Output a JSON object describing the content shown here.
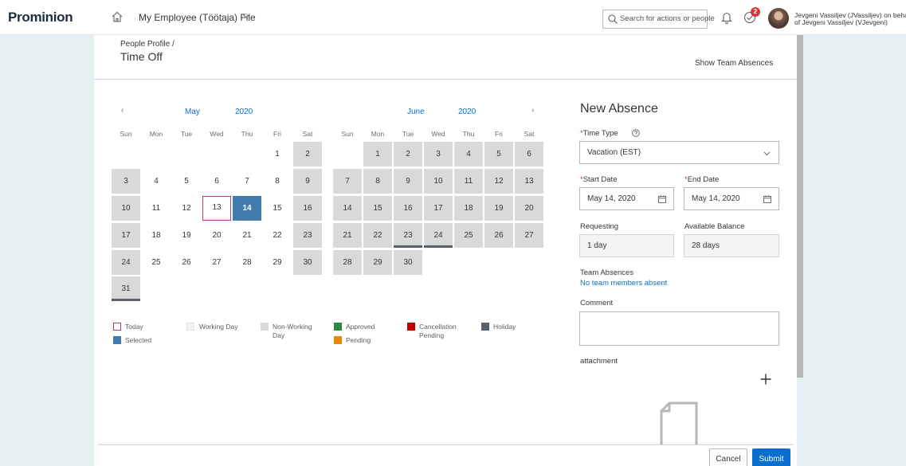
{
  "header": {
    "logo_main": "Prominion",
    "app_title": "My Employee (Töötaja) File",
    "search_placeholder": "Search for actions or people",
    "notifications_count": "2",
    "user_line1": "Jevgeni Vassiljev (JVassiljev) on behalf",
    "user_line2": "of Jevgeni Vassiljev (VJevgeni)"
  },
  "page": {
    "breadcrumb": "People Profile /",
    "title": "Time Off",
    "team_link": "Show Team Absences"
  },
  "calendar": {
    "weekdays": [
      "Sun",
      "Mon",
      "Tue",
      "Wed",
      "Thu",
      "Fri",
      "Sat"
    ],
    "months": [
      {
        "name": "May",
        "year": "2020",
        "weeks": [
          [
            null,
            null,
            null,
            null,
            null,
            {
              "d": "1",
              "t": "working"
            },
            {
              "d": "2",
              "t": "nonworking"
            }
          ],
          [
            {
              "d": "3",
              "t": "nonworking"
            },
            {
              "d": "4",
              "t": "working"
            },
            {
              "d": "5",
              "t": "working"
            },
            {
              "d": "6",
              "t": "working"
            },
            {
              "d": "7",
              "t": "working"
            },
            {
              "d": "8",
              "t": "working"
            },
            {
              "d": "9",
              "t": "nonworking"
            }
          ],
          [
            {
              "d": "10",
              "t": "nonworking"
            },
            {
              "d": "11",
              "t": "working"
            },
            {
              "d": "12",
              "t": "working"
            },
            {
              "d": "13",
              "t": "today"
            },
            {
              "d": "14",
              "t": "selected"
            },
            {
              "d": "15",
              "t": "working"
            },
            {
              "d": "16",
              "t": "nonworking"
            }
          ],
          [
            {
              "d": "17",
              "t": "nonworking"
            },
            {
              "d": "18",
              "t": "working"
            },
            {
              "d": "19",
              "t": "working"
            },
            {
              "d": "20",
              "t": "working"
            },
            {
              "d": "21",
              "t": "working"
            },
            {
              "d": "22",
              "t": "working"
            },
            {
              "d": "23",
              "t": "nonworking"
            }
          ],
          [
            {
              "d": "24",
              "t": "nonworking"
            },
            {
              "d": "25",
              "t": "working"
            },
            {
              "d": "26",
              "t": "working"
            },
            {
              "d": "27",
              "t": "working"
            },
            {
              "d": "28",
              "t": "working"
            },
            {
              "d": "29",
              "t": "working"
            },
            {
              "d": "30",
              "t": "nonworking"
            }
          ],
          [
            {
              "d": "31",
              "t": "nonworking",
              "holiday": true
            },
            null,
            null,
            null,
            null,
            null,
            null
          ]
        ]
      },
      {
        "name": "June",
        "year": "2020",
        "weeks": [
          [
            null,
            {
              "d": "1",
              "t": "nonworking"
            },
            {
              "d": "2",
              "t": "nonworking"
            },
            {
              "d": "3",
              "t": "nonworking"
            },
            {
              "d": "4",
              "t": "nonworking"
            },
            {
              "d": "5",
              "t": "nonworking"
            },
            {
              "d": "6",
              "t": "nonworking"
            }
          ],
          [
            {
              "d": "7",
              "t": "nonworking"
            },
            {
              "d": "8",
              "t": "nonworking"
            },
            {
              "d": "9",
              "t": "nonworking"
            },
            {
              "d": "10",
              "t": "nonworking"
            },
            {
              "d": "11",
              "t": "nonworking"
            },
            {
              "d": "12",
              "t": "nonworking"
            },
            {
              "d": "13",
              "t": "nonworking"
            }
          ],
          [
            {
              "d": "14",
              "t": "nonworking"
            },
            {
              "d": "15",
              "t": "nonworking"
            },
            {
              "d": "16",
              "t": "nonworking"
            },
            {
              "d": "17",
              "t": "nonworking"
            },
            {
              "d": "18",
              "t": "nonworking"
            },
            {
              "d": "19",
              "t": "nonworking"
            },
            {
              "d": "20",
              "t": "nonworking"
            }
          ],
          [
            {
              "d": "21",
              "t": "nonworking"
            },
            {
              "d": "22",
              "t": "nonworking"
            },
            {
              "d": "23",
              "t": "nonworking",
              "holiday": true
            },
            {
              "d": "24",
              "t": "nonworking",
              "holiday": true
            },
            {
              "d": "25",
              "t": "nonworking"
            },
            {
              "d": "26",
              "t": "nonworking"
            },
            {
              "d": "27",
              "t": "nonworking"
            }
          ],
          [
            {
              "d": "28",
              "t": "nonworking"
            },
            {
              "d": "29",
              "t": "nonworking"
            },
            {
              "d": "30",
              "t": "nonworking"
            },
            null,
            null,
            null,
            null
          ]
        ]
      }
    ]
  },
  "legend": {
    "today": "Today",
    "working": "Working Day",
    "nonworking_1": "Non-Working",
    "nonworking_2": "Day",
    "approved": "Approved",
    "cancellation_1": "Cancellation",
    "cancellation_2": "Pending",
    "holiday": "Holiday",
    "selected": "Selected",
    "pending": "Pending",
    "colors": {
      "today_border": "#a0407a",
      "working": "#f2f2f2",
      "nonworking": "#d9d9d9",
      "approved": "#2b8a3e",
      "cancellation": "#c00000",
      "holiday": "#596068",
      "selected": "#427cac",
      "pending": "#e8890c"
    }
  },
  "form": {
    "title": "New Absence",
    "time_type_label": "Time Type",
    "time_type_value": "Vacation (EST)",
    "start_label": "Start Date",
    "start_value": "May 14, 2020",
    "end_label": "End Date",
    "end_value": "May 14, 2020",
    "requesting_label": "Requesting",
    "requesting_value": "1 day",
    "balance_label": "Available Balance",
    "balance_value": "28 days",
    "team_absences_label": "Team Absences",
    "team_absences_value": "No team members absent",
    "comment_label": "Comment",
    "attachment_label": "attachment"
  },
  "footer": {
    "cancel": "Cancel",
    "submit": "Submit"
  }
}
